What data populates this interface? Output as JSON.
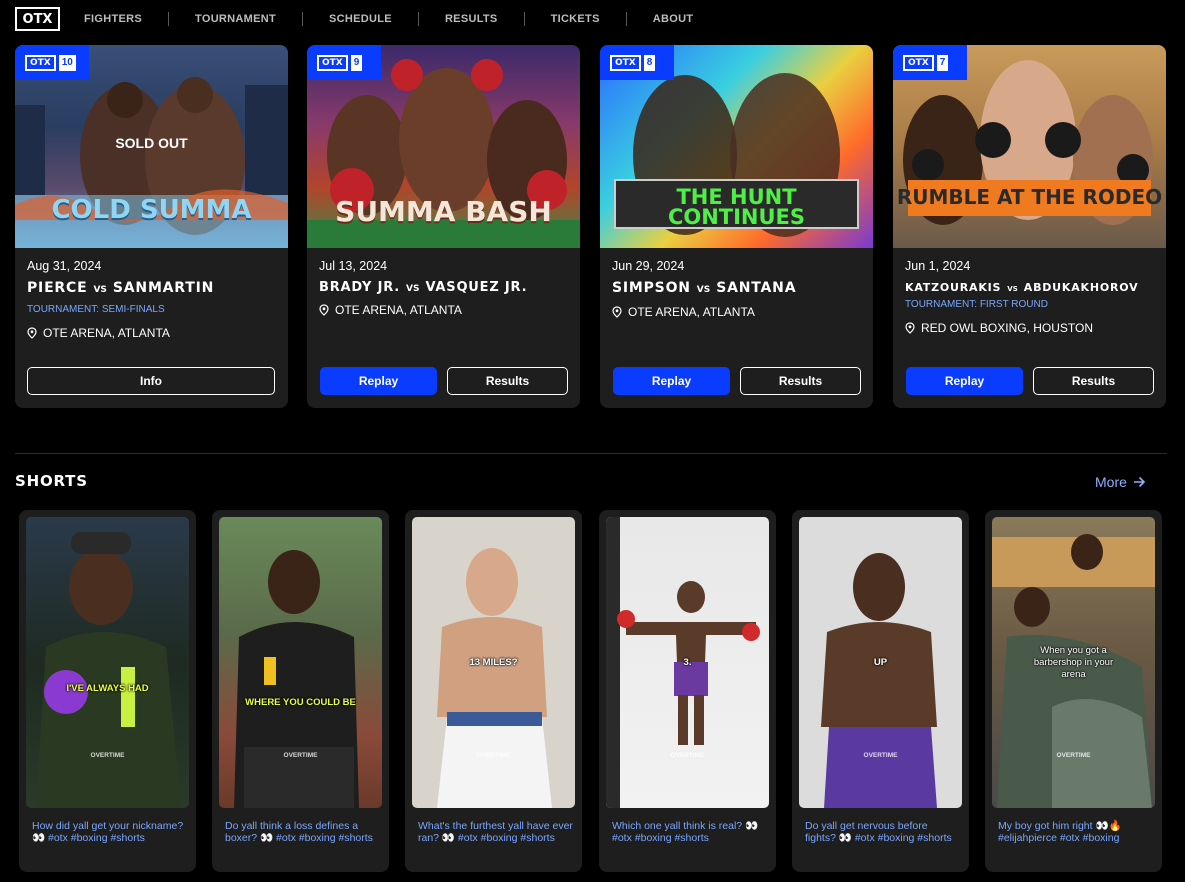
{
  "nav": {
    "logo": "OTX",
    "items": [
      "FIGHTERS",
      "TOURNAMENT",
      "SCHEDULE",
      "RESULTS",
      "TICKETS",
      "ABOUT"
    ]
  },
  "events": [
    {
      "badge_logo": "OTX",
      "badge_num": "10",
      "poster_text": "COLD SUMMA",
      "overlay": "SOLD OUT",
      "date": "Aug 31, 2024",
      "fighter1": "PIERCE",
      "vs": "VS",
      "fighter2": "SANMARTIN",
      "tournament": "TOURNAMENT: SEMI-FINALS",
      "location": "OTE ARENA, ATLANTA",
      "info_label": "Info"
    },
    {
      "badge_logo": "OTX",
      "badge_num": "9",
      "poster_text": "SUMMA BASH",
      "date": "Jul 13, 2024",
      "fighter1": "BRADY JR.",
      "vs": "VS",
      "fighter2": "VASQUEZ JR.",
      "location": "OTE ARENA, ATLANTA",
      "replay_label": "Replay",
      "results_label": "Results"
    },
    {
      "badge_logo": "OTX",
      "badge_num": "8",
      "poster_text": "THE HUNT CONTINUES",
      "date": "Jun 29, 2024",
      "fighter1": "SIMPSON",
      "vs": "VS",
      "fighter2": "SANTANA",
      "location": "OTE ARENA, ATLANTA",
      "replay_label": "Replay",
      "results_label": "Results"
    },
    {
      "badge_logo": "OTX",
      "badge_num": "7",
      "poster_text": "RUMBLE AT THE RODEO",
      "date": "Jun 1, 2024",
      "fighter1": "KATZOURAKIS",
      "vs": "VS",
      "fighter2": "ABDUKAKHOROV",
      "tournament": "TOURNAMENT: FIRST ROUND",
      "location": "RED OWL BOXING, HOUSTON",
      "replay_label": "Replay",
      "results_label": "Results"
    }
  ],
  "shorts": {
    "title": "SHORTS",
    "more_label": "More",
    "items": [
      {
        "overlay": "I'VE ALWAYS HAD",
        "watermark": "OVERTIME",
        "caption": "How did yall get your nickname? 👀 #otx #boxing #shorts"
      },
      {
        "overlay": "WHERE YOU COULD BE",
        "watermark": "OVERTIME",
        "caption": "Do yall think a loss defines a boxer? 👀 #otx #boxing #shorts"
      },
      {
        "overlay": "13 MILES?",
        "watermark": "OVERTIME",
        "caption": "What's the furthest yall have ever ran? 👀 #otx #boxing #shorts"
      },
      {
        "overlay": "3.",
        "watermark": "OVERTIME",
        "caption": "Which one yall think is real? 👀 #otx #boxing #shorts"
      },
      {
        "overlay": "UP",
        "watermark": "OVERTIME",
        "caption": "Do yall get nervous before fights? 👀 #otx #boxing #shorts"
      },
      {
        "overlay": "When you got a barbershop in your arena",
        "watermark": "OVERTIME",
        "caption": "My boy got him right 👀🔥 #elijahpierce #otx #boxing"
      }
    ]
  },
  "colors": {
    "accent": "#0a3cff",
    "link": "#7aa6ff",
    "card": "#1e1e1e"
  }
}
